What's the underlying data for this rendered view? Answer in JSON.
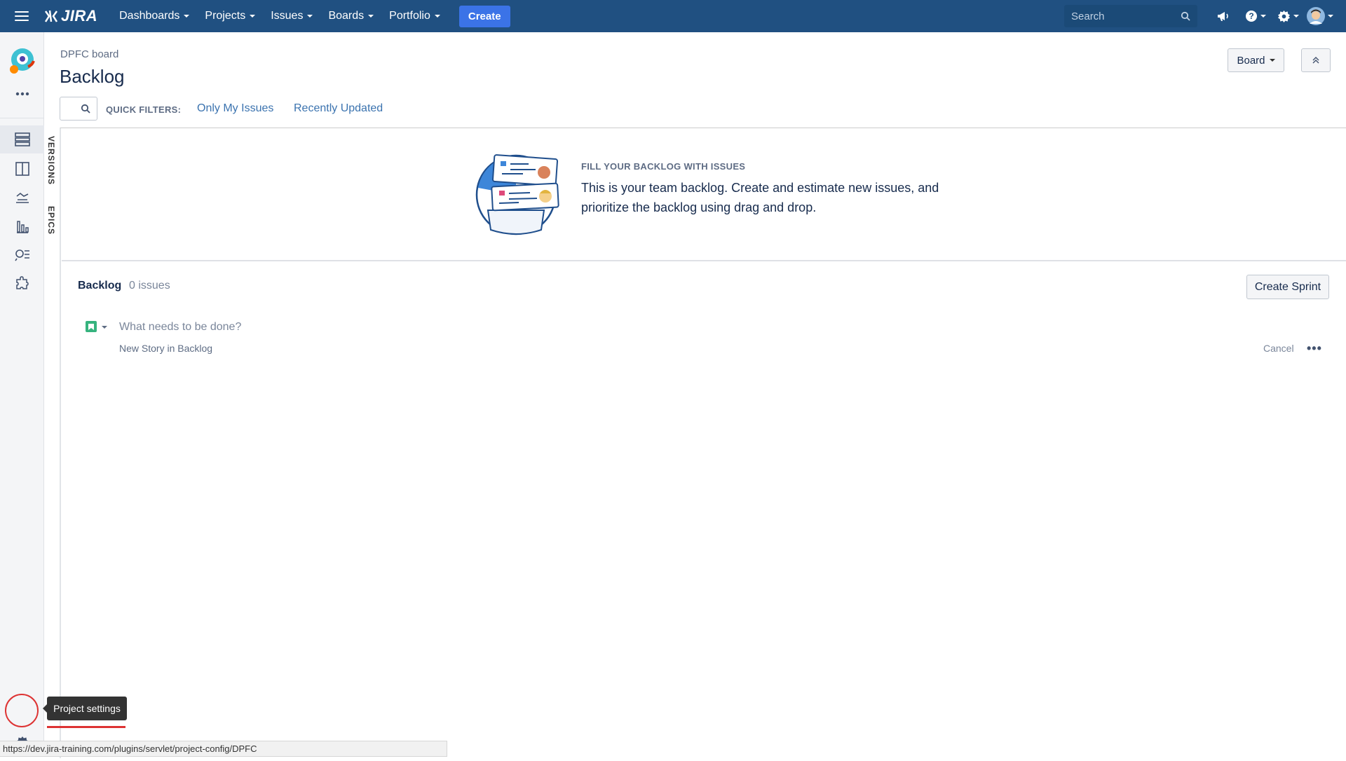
{
  "topbar": {
    "logo_text": "JIRA",
    "nav": [
      {
        "label": "Dashboards"
      },
      {
        "label": "Projects"
      },
      {
        "label": "Issues"
      },
      {
        "label": "Boards"
      },
      {
        "label": "Portfolio"
      }
    ],
    "create_label": "Create",
    "search_placeholder": "Search"
  },
  "sidebar": {
    "items": [
      {
        "icon": "backlog-icon",
        "label": "Backlog",
        "active": true
      },
      {
        "icon": "board-icon",
        "label": "Active sprints"
      },
      {
        "icon": "releases-icon",
        "label": "Releases"
      },
      {
        "icon": "reports-icon",
        "label": "Reports"
      },
      {
        "icon": "issues-icon",
        "label": "Issues"
      },
      {
        "icon": "components-icon",
        "label": "Components"
      }
    ]
  },
  "vertical_tabs": {
    "versions": "VERSIONS",
    "epics": "EPICS"
  },
  "header": {
    "breadcrumb": "DPFC board",
    "title": "Backlog",
    "board_button": "Board"
  },
  "quick_filters": {
    "label": "QUICK FILTERS:",
    "filters": [
      "Only My Issues",
      "Recently Updated"
    ]
  },
  "empty_state": {
    "title": "FILL YOUR BACKLOG WITH ISSUES",
    "text": "This is your team backlog. Create and estimate new issues, and prioritize the backlog using drag and drop."
  },
  "backlog": {
    "title": "Backlog",
    "count": "0 issues",
    "create_sprint": "Create Sprint",
    "placeholder": "What needs to be done?",
    "hint": "New Story in Backlog",
    "cancel": "Cancel",
    "more": "•••"
  },
  "tooltip": "Project settings",
  "statusbar": "https://dev.jira-training.com/plugins/servlet/project-config/DPFC",
  "colors": {
    "nav_bg": "#205081",
    "create_bg": "#3b73e7",
    "link": "#3b73af",
    "story": "#36b37e",
    "highlight": "#dd3333"
  }
}
